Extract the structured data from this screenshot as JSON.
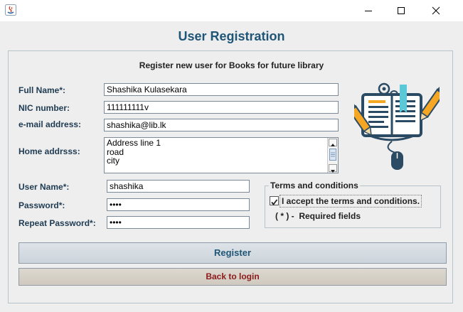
{
  "window": {
    "icon": "java-icon",
    "controls": [
      "minimize-icon",
      "maximize-icon",
      "close-icon"
    ]
  },
  "header": {
    "title": "User Registration",
    "subtitle": "Register new user for Books for future library"
  },
  "form": {
    "full_name": {
      "label": "Full Name*:",
      "value": "Shashika Kulasekara"
    },
    "nic": {
      "label": "NIC number:",
      "value": "111111111v"
    },
    "email": {
      "label": "e-mail address:",
      "value": "shashika@lib.lk"
    },
    "home_address": {
      "label": "Home addrsss:",
      "lines": [
        "Address line 1",
        "road",
        "city"
      ]
    },
    "username": {
      "label": "User Name*:",
      "value": "shashika"
    },
    "password": {
      "label": "Password*:",
      "value": "••••"
    },
    "repeat_password": {
      "label": "Repeat Password*:",
      "value": "••••"
    }
  },
  "terms": {
    "title": "Terms and conditions",
    "checkbox_label": "I accept the terms and conditions.",
    "checked": true,
    "required_note": "( * ) -  Required fields"
  },
  "buttons": {
    "register": "Register",
    "back": "Back to login"
  },
  "illustration": {
    "icon": "book-with-pencils-and-mouse-icon",
    "colors": {
      "primary": "#2b4a63",
      "accent": "#f5a623",
      "cyan": "#5bc8d8"
    }
  },
  "colors": {
    "title": "#1f5576",
    "back_text": "#8b1a1a"
  }
}
